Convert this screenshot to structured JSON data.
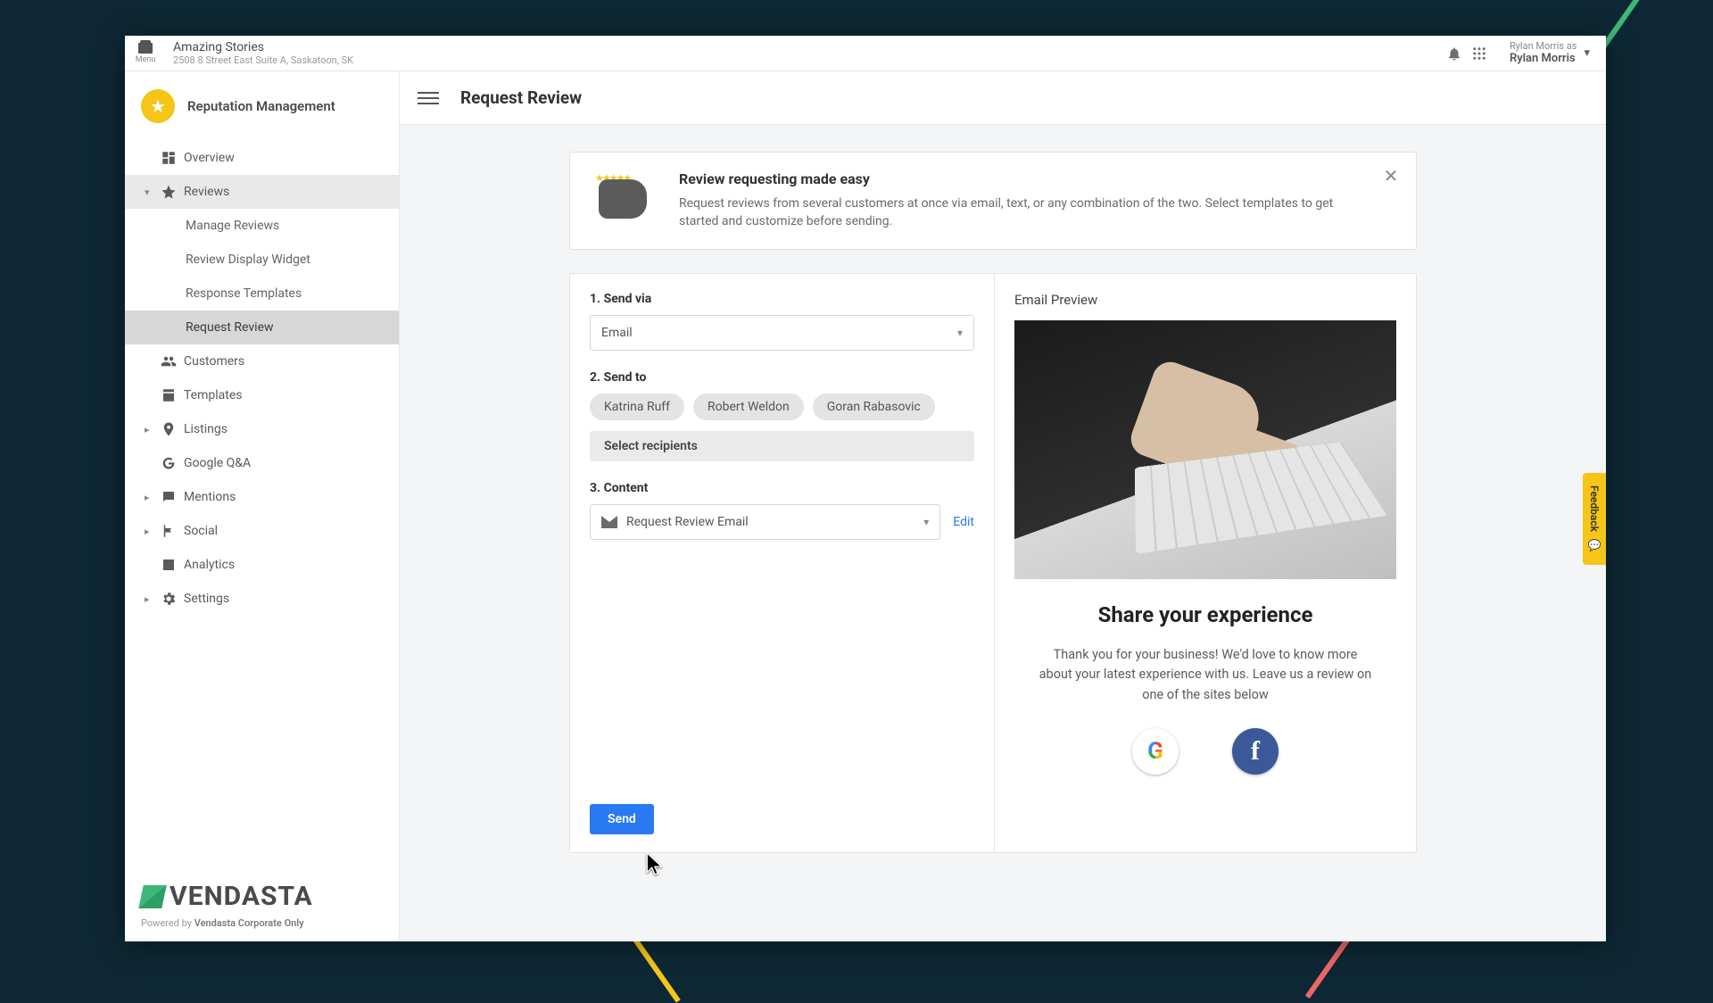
{
  "topbar": {
    "menu_label": "Menu",
    "business_name": "Amazing Stories",
    "business_address": "2508 8 Street East Suite A, Saskatoon, SK",
    "user_as": "Rylan Morris as",
    "user_name": "Rylan Morris"
  },
  "sidebar": {
    "product_name": "Reputation Management",
    "items": {
      "overview": "Overview",
      "reviews": "Reviews",
      "manage_reviews": "Manage Reviews",
      "review_display_widget": "Review Display Widget",
      "response_templates": "Response Templates",
      "request_review": "Request Review",
      "customers": "Customers",
      "templates": "Templates",
      "listings": "Listings",
      "google_qa": "Google Q&A",
      "mentions": "Mentions",
      "social": "Social",
      "analytics": "Analytics",
      "settings": "Settings"
    },
    "footer": {
      "brand": "VENDASTA",
      "powered_by_prefix": "Powered by ",
      "powered_by_name": "Vendasta Corporate Only"
    }
  },
  "header": {
    "title": "Request Review"
  },
  "banner": {
    "title": "Review requesting made easy",
    "body": "Request reviews from several customers at once via email, text, or any combination of the two. Select templates to get started and customize before sending."
  },
  "form": {
    "step1_label": "1. Send via",
    "send_via_value": "Email",
    "step2_label": "2. Send to",
    "recipients": [
      "Katrina Ruff",
      "Robert Weldon",
      "Goran Rabasovic"
    ],
    "select_recipients": "Select recipients",
    "step3_label": "3. Content",
    "content_value": "Request Review Email",
    "edit": "Edit",
    "send": "Send"
  },
  "preview": {
    "panel_title": "Email Preview",
    "heading": "Share your experience",
    "body": "Thank you for your business! We'd love to know more about your latest experience with us. Leave us a review on one of the sites below"
  },
  "feedback_tab": "Feedback"
}
